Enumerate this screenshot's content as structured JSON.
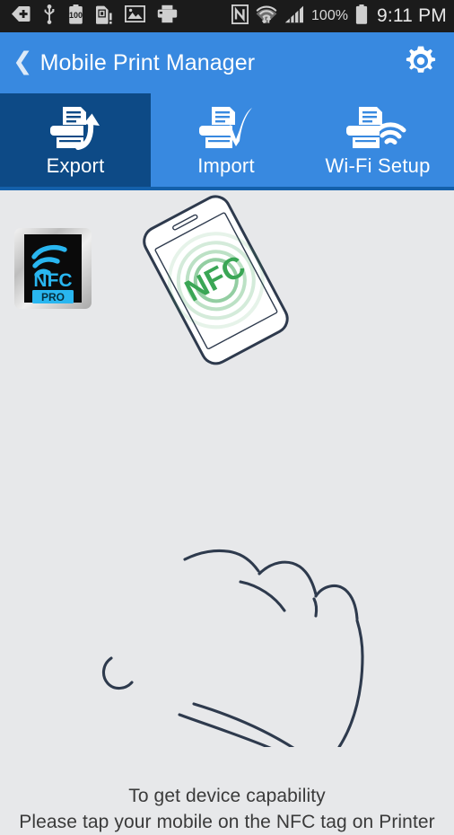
{
  "status_bar": {
    "icons": [
      {
        "name": "back-arrow-tag-icon",
        "glyph": "tag-arrow"
      },
      {
        "name": "usb-icon",
        "glyph": "usb"
      },
      {
        "name": "battery-100-icon",
        "glyph": "battery-100"
      },
      {
        "name": "sd-card-alert-icon",
        "glyph": "sd-alert"
      },
      {
        "name": "image-icon",
        "glyph": "image"
      },
      {
        "name": "printer-icon",
        "glyph": "printer"
      },
      {
        "name": "nfc-icon",
        "glyph": "nfc"
      },
      {
        "name": "wifi-icon",
        "glyph": "wifi"
      },
      {
        "name": "cellular-signal-icon",
        "glyph": "signal"
      }
    ],
    "battery_percent": "100%",
    "clock": "9:11 PM",
    "background": "#1b1b1b"
  },
  "header": {
    "back_label": "❮",
    "title": "Mobile Print Manager",
    "settings_icon": "gear-icon",
    "background": "#3889e0"
  },
  "tabs": {
    "items": [
      {
        "label": "Export",
        "icon": "printer-export-icon",
        "selected": true
      },
      {
        "label": "Import",
        "icon": "printer-import-icon",
        "selected": false
      },
      {
        "label": "Wi-Fi Setup",
        "icon": "printer-wifi-icon",
        "selected": false
      }
    ],
    "selected_background": "#0d4a86",
    "background": "#3889e0",
    "underline_color": "#1460aa"
  },
  "main": {
    "background": "#e7e8ea",
    "illustration": {
      "name": "nfc-tap-illustration",
      "nfc_tag": {
        "label": "NFC",
        "badge": "PRO",
        "label_color": "#29b6f0",
        "badge_bg": "#29b6f0",
        "badge_text_color": "#0b2430",
        "tag_bg": "#0a0a0a"
      },
      "phone": {
        "screen_logo": "NFC",
        "logo_color": "#3aa655"
      },
      "hand_outline_color": "#2e3a4d"
    },
    "caption": {
      "line1": "To get device capability",
      "line2": "Please tap your mobile on the NFC tag on Printer",
      "color": "#3a3a3a"
    }
  }
}
